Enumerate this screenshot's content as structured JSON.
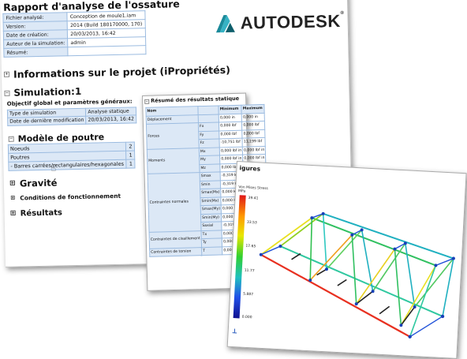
{
  "report": {
    "title": "Rapport d'analyse de l'ossature",
    "meta": [
      {
        "label": "Fichier analysé:",
        "value": "Conception de moule1.iam"
      },
      {
        "label": "Version:",
        "value": "2014 (Build 180170000, 170)"
      },
      {
        "label": "Date de création:",
        "value": "20/03/2013, 16:42"
      },
      {
        "label": "Auteur de la simulation:",
        "value": "admin"
      },
      {
        "label": "Résumé:",
        "value": ""
      }
    ],
    "logo_text": "AUTODESK",
    "logo_reg": "®",
    "sections": {
      "info": "Informations sur le projet (iPropriétés)",
      "simulation": "Simulation:1",
      "objective": "Objectif global et paramètres généraux:",
      "model": "Modèle de poutre",
      "gravity": "Gravité",
      "conditions": "Conditions de fonctionnement",
      "results": "Résultats"
    },
    "sim_table": [
      {
        "label": "Type de simulation",
        "value": "Analyse statique"
      },
      {
        "label": "Date de dernière modification",
        "value": "20/03/2013, 16:42"
      }
    ],
    "model_table": [
      {
        "label": "Noeuds",
        "value": "2"
      },
      {
        "label": "Poutres",
        "value": "1"
      },
      {
        "label": "- Barres carrées/rectangulaires/hexagonales",
        "value": "1"
      }
    ]
  },
  "summary": {
    "title": "Résumé des résultats statique",
    "headers": [
      "Nom",
      "",
      "Minimum",
      "Maximum"
    ],
    "groups": [
      {
        "name": "Déplacement",
        "rows": [
          {
            "comp": "",
            "min": "0,000 in",
            "max": "0,000 in"
          }
        ]
      },
      {
        "name": "Forces",
        "rows": [
          {
            "comp": "Fx",
            "min": "0,000 lbf",
            "max": "0,000 lbf"
          },
          {
            "comp": "Fy",
            "min": "0,000 lbf",
            "max": "0,000 lbf"
          },
          {
            "comp": "Fz",
            "min": "-10,751 lbf",
            "max": "11,199 lbf"
          }
        ]
      },
      {
        "name": "Moments",
        "rows": [
          {
            "comp": "Mx",
            "min": "0,000 lbf in",
            "max": "0,000 lbf in"
          },
          {
            "comp": "My",
            "min": "0,000 lbf in",
            "max": "0,000 lbf in"
          },
          {
            "comp": "Mz",
            "min": "0,000 lbf in",
            "max": "0,000 lbf in"
          }
        ]
      },
      {
        "name": "Contraintes normales",
        "rows": [
          {
            "comp": "Smax",
            "min": "-0,319 ksi",
            "max": "0,306 ksi"
          },
          {
            "comp": "Smin",
            "min": "-0,319 ksi",
            "max": "0,306 ksi"
          },
          {
            "comp": "Smax(Mx)",
            "min": "0,000 ksi",
            "max": "0,000 ksi"
          },
          {
            "comp": "Smin(Mx)",
            "min": "0,000 ksi",
            "max": "0,000 ksi"
          },
          {
            "comp": "Smax(My)",
            "min": "0,000 ksi",
            "max": "0,000 ksi"
          },
          {
            "comp": "Smin(My)",
            "min": "0,000 ksi",
            "max": "0,000 ksi"
          },
          {
            "comp": "Saxial",
            "min": "-0,319 ksi",
            "max": "0,306 ksi"
          }
        ]
      },
      {
        "name": "Contraintes de cisaillement",
        "rows": [
          {
            "comp": "Tx",
            "min": "0,000 ksi",
            "max": "0,000 ksi"
          },
          {
            "comp": "Ty",
            "min": "0,000 ksi",
            "max": "0,000 ksi"
          }
        ]
      },
      {
        "name": "Contraintes de torsion",
        "rows": [
          {
            "comp": "T",
            "min": "0,000 ksi",
            "max": "0,000 ksi"
          }
        ]
      }
    ]
  },
  "figures": {
    "title": "igures",
    "legend_title": "Von Mises Stress",
    "legend_unit": "MPa",
    "ticks": [
      "39.41",
      "33.53",
      "17.65",
      "11.77",
      "5.887",
      "0.000"
    ],
    "colors": {
      "max": "#e01818",
      "high": "#ff9900",
      "mid": "#e8e800",
      "midlow": "#30d030",
      "low": "#20c0c0",
      "lower": "#2050e8",
      "min": "#101090"
    }
  }
}
